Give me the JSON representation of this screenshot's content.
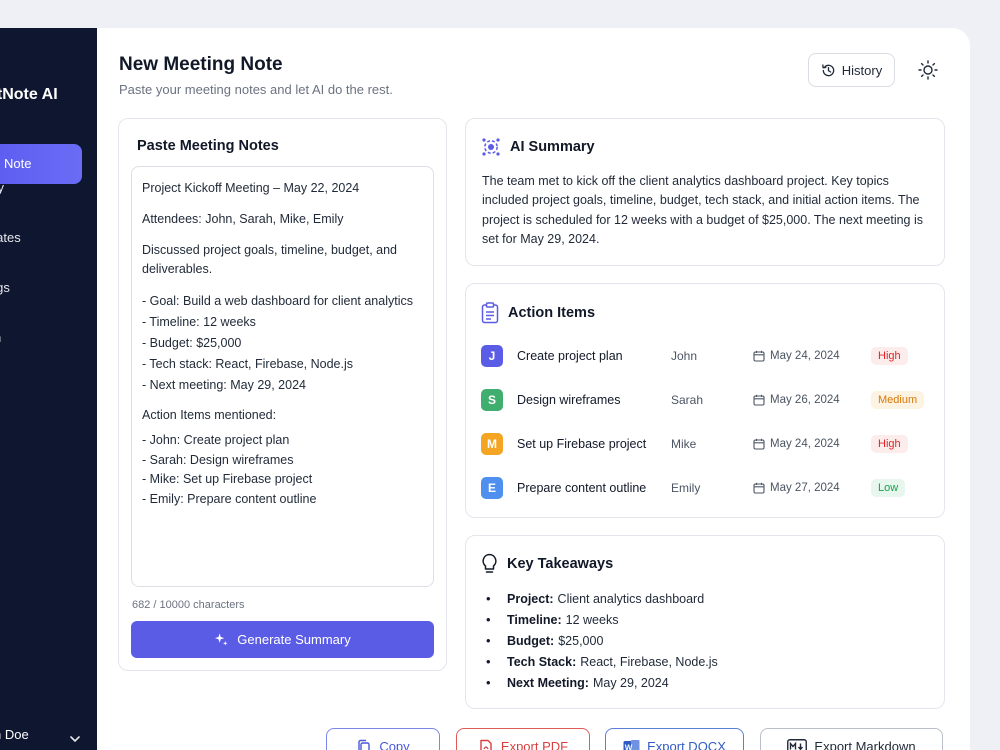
{
  "sidebar": {
    "brand": "etNote AI",
    "items": [
      {
        "label": "Note",
        "active": true
      },
      {
        "label": "ory"
      },
      {
        "label": "plates"
      },
      {
        "label": "ings"
      },
      {
        "label": "n"
      }
    ],
    "user": "n Doe"
  },
  "header": {
    "title": "New Meeting Note",
    "subtitle": "Paste your meeting notes and let AI do the rest.",
    "history_label": "History"
  },
  "notes": {
    "title": "Paste Meeting Notes",
    "line1": "Project Kickoff Meeting – May 22, 2024",
    "line2": "Attendees: John, Sarah, Mike, Emily",
    "line3": "Discussed project goals, timeline, budget, and deliverables.",
    "bullets": [
      "- Goal: Build a web dashboard for client analytics",
      "- Timeline: 12 weeks",
      "- Budget: $25,000",
      "- Tech stack: React, Firebase, Node.js",
      "- Next meeting: May 29, 2024"
    ],
    "actions_heading": "Action Items mentioned:",
    "action_bullets": [
      "- John: Create project plan",
      "- Sarah: Design wireframes",
      "- Mike: Set up Firebase project",
      "- Emily: Prepare content outline"
    ],
    "char_count": "682 / 10000 characters",
    "generate_label": "Generate Summary"
  },
  "summary": {
    "title": "AI Summary",
    "text": "The team met to kick off the client analytics dashboard project. Key topics included project goals, timeline, budget, tech stack, and initial action items. The project is scheduled for 12 weeks with a budget of $25,000. The next meeting is set for May 29, 2024."
  },
  "actions": {
    "title": "Action Items",
    "rows": [
      {
        "initial": "J",
        "color": "#5b5ce6",
        "task": "Create project plan",
        "assignee": "John",
        "due": "May 24, 2024",
        "priority": "High"
      },
      {
        "initial": "S",
        "color": "#3fae6f",
        "task": "Design wireframes",
        "assignee": "Sarah",
        "due": "May 26, 2024",
        "priority": "Medium"
      },
      {
        "initial": "M",
        "color": "#f5a524",
        "task": "Set up Firebase project",
        "assignee": "Mike",
        "due": "May 24, 2024",
        "priority": "High"
      },
      {
        "initial": "E",
        "color": "#4f8ff0",
        "task": "Prepare content outline",
        "assignee": "Emily",
        "due": "May 27, 2024",
        "priority": "Low"
      }
    ],
    "priority_colors": {
      "High": {
        "fg": "#dc2626",
        "bg": "#fdecec"
      },
      "Medium": {
        "fg": "#d97706",
        "bg": "#fdf3e2"
      },
      "Low": {
        "fg": "#16a34a",
        "bg": "#e8f7ee"
      }
    }
  },
  "takeaways": {
    "title": "Key Takeaways",
    "items": [
      {
        "label": "Project:",
        "value": "Client analytics dashboard"
      },
      {
        "label": "Timeline:",
        "value": "12 weeks"
      },
      {
        "label": "Budget:",
        "value": "$25,000"
      },
      {
        "label": "Tech Stack:",
        "value": "React, Firebase, Node.js"
      },
      {
        "label": "Next Meeting:",
        "value": "May 29, 2024"
      }
    ]
  },
  "exports": {
    "copy": "Copy",
    "pdf": "Export PDF",
    "docx": "Export DOCX",
    "markdown": "Export Markdown"
  }
}
